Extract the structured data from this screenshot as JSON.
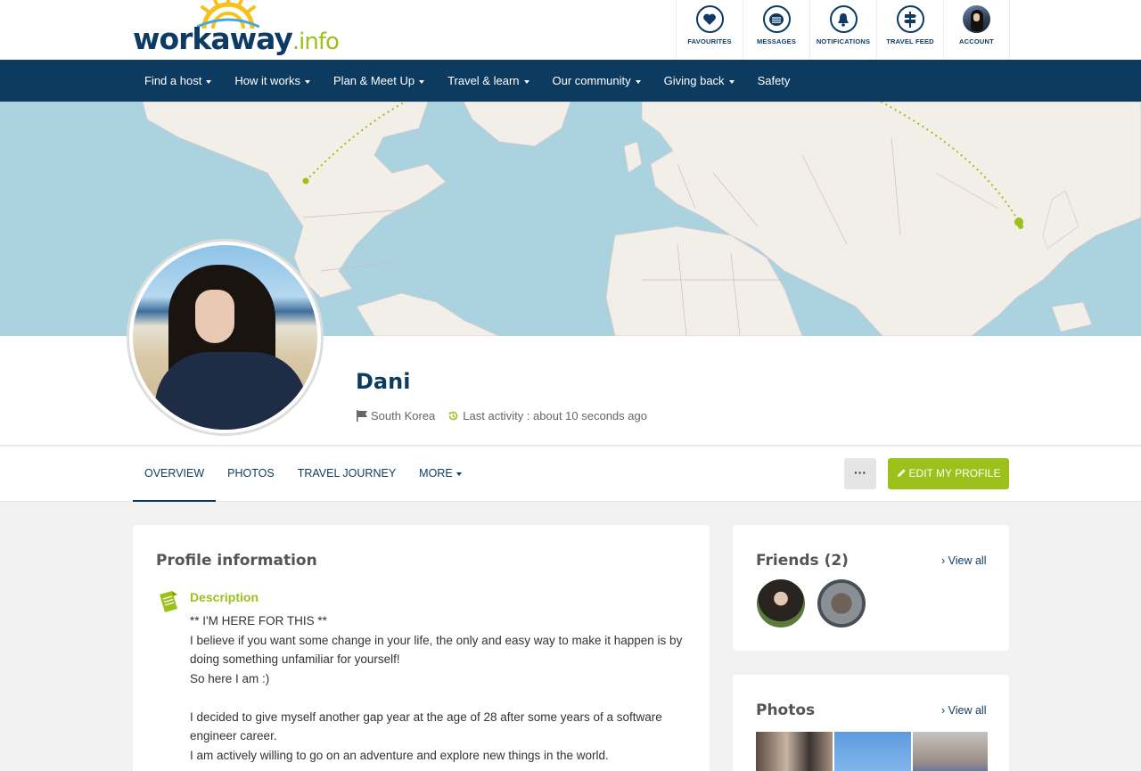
{
  "brand": {
    "logo_main": "workaway",
    "logo_suffix": ".info"
  },
  "top_icons": [
    {
      "label": "FAVOURITES",
      "icon": "heart-icon"
    },
    {
      "label": "MESSAGES",
      "icon": "envelope-icon"
    },
    {
      "label": "NOTIFICATIONS",
      "icon": "bell-icon"
    },
    {
      "label": "TRAVEL FEED",
      "icon": "signpost-icon"
    },
    {
      "label": "ACCOUNT",
      "icon": "avatar"
    }
  ],
  "nav": [
    {
      "label": "Find a host",
      "dropdown": true
    },
    {
      "label": "How it works",
      "dropdown": true
    },
    {
      "label": "Plan & Meet Up",
      "dropdown": true
    },
    {
      "label": "Travel & learn",
      "dropdown": true
    },
    {
      "label": "Our community",
      "dropdown": true
    },
    {
      "label": "Giving back",
      "dropdown": true
    },
    {
      "label": "Safety",
      "dropdown": false
    }
  ],
  "profile": {
    "name": "Dani",
    "country": "South Korea",
    "last_activity": "Last activity : about 10 seconds ago"
  },
  "tabs": [
    {
      "label": "OVERVIEW",
      "active": true
    },
    {
      "label": "PHOTOS",
      "active": false
    },
    {
      "label": "TRAVEL JOURNEY",
      "active": false
    },
    {
      "label": "MORE",
      "active": false
    }
  ],
  "actions": {
    "more_label": "···",
    "edit_label": "EDIT MY PROFILE"
  },
  "profile_info": {
    "title": "Profile information",
    "description_title": "Description",
    "description": [
      "** I'M HERE FOR THIS **",
      "I believe if you want some change in your life, the only and easy way to make it happen is by doing something unfamiliar for yourself!",
      "So here I am :)",
      "",
      "I decided to give myself another gap year at the age of 28 after some years of a software engineer career.",
      "I am actively willing to go on an adventure and explore new things in the world."
    ]
  },
  "friends": {
    "title": "Friends (2)",
    "view_all": "View all"
  },
  "photos": {
    "title": "Photos",
    "view_all": "View all"
  },
  "colors": {
    "brand_navy": "#0d3b5f",
    "brand_green": "#9cc11b",
    "map_water": "#aad3df",
    "map_land": "#f2efe9"
  }
}
